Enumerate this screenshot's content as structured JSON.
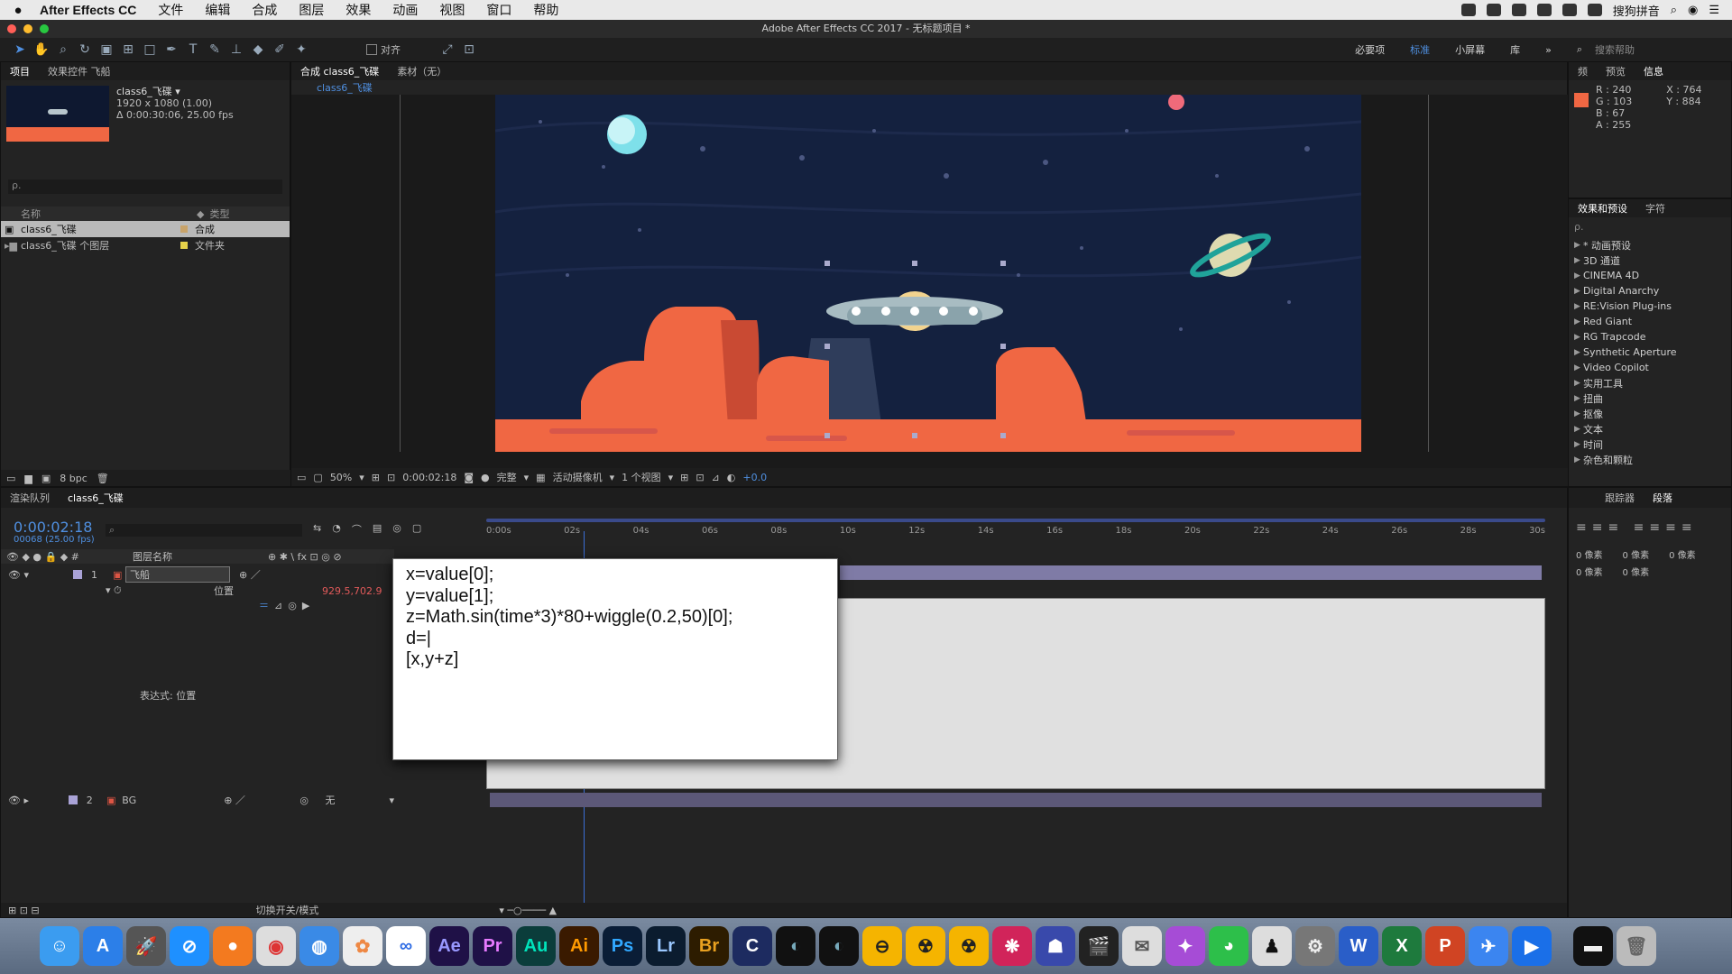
{
  "menubar": {
    "app_name": "After Effects CC",
    "menus": [
      "文件",
      "编辑",
      "合成",
      "图层",
      "效果",
      "动画",
      "视图",
      "窗口",
      "帮助"
    ],
    "input_method": "搜狗拼音"
  },
  "window": {
    "title": "Adobe After Effects CC 2017 - 无标题项目 *"
  },
  "toolbar": {
    "align_label": "对齐",
    "workspaces": [
      "必要项",
      "标准",
      "小屏幕",
      "库"
    ],
    "active_workspace": "标准",
    "search_help": "搜索帮助"
  },
  "project_panel": {
    "tabs": [
      "项目",
      "效果控件 飞船"
    ],
    "comp_name": "class6_飞碟 ▾",
    "comp_size": "1920 x 1080 (1.00)",
    "comp_duration": "Δ 0:00:30:06, 25.00 fps",
    "search_placeholder": "ρ.",
    "col_name": "名称",
    "col_type": "类型",
    "items": [
      {
        "name": "class6_飞碟",
        "type": "合成"
      },
      {
        "name": "class6_飞碟 个图层",
        "type": "文件夹"
      }
    ],
    "bpc": "8 bpc"
  },
  "viewer": {
    "tabs": [
      "合成 class6_飞碟",
      "素材（无）"
    ],
    "breadcrumb": "class6_飞碟",
    "zoom": "50%",
    "timecode": "0:00:02:18",
    "quality": "完整",
    "camera": "活动摄像机",
    "views": "1 个视图",
    "exposure": "+0.0"
  },
  "info_panel": {
    "tabs": [
      "频",
      "预览",
      "信息"
    ],
    "r": "R : 240",
    "g": "G : 103",
    "b": "B : 67",
    "a": "A : 255",
    "x": "X : 764",
    "y": "Y : 884",
    "swatch": "#f06743"
  },
  "effects_panel": {
    "tabs": [
      "效果和预设",
      "字符"
    ],
    "search_placeholder": "ρ.",
    "items": [
      "* 动画预设",
      "3D 通道",
      "CINEMA 4D",
      "Digital Anarchy",
      "RE:Vision Plug-ins",
      "Red Giant",
      "RG Trapcode",
      "Synthetic Aperture",
      "Video Copilot",
      "实用工具",
      "扭曲",
      "抠像",
      "文本",
      "时间",
      "杂色和颗粒"
    ]
  },
  "timeline": {
    "tabs": [
      "渲染队列",
      "class6_飞碟"
    ],
    "timecode": "0:00:02:18",
    "frame_info": "00068 (25.00 fps)",
    "col_layer_name": "图层名称",
    "layers": [
      {
        "num": "1",
        "name": "飞船"
      },
      {
        "num": "2",
        "name": "BG",
        "parent": "无"
      }
    ],
    "property_name": "位置",
    "property_value": "929.5,702.9",
    "expression_label": "表达式: 位置",
    "ruler": [
      "0:00s",
      "02s",
      "04s",
      "06s",
      "08s",
      "10s",
      "12s",
      "14s",
      "16s",
      "18s",
      "20s",
      "22s",
      "24s",
      "26s",
      "28s",
      "30s"
    ],
    "toggle_label": "切换开关/模式",
    "expression_lines": [
      "x=value[0];",
      "y=value[1];",
      "z=Math.sin(time*3)*80+wiggle(0.2,50)[0];",
      "d=|",
      "[x,y+z]"
    ]
  },
  "tracker_panel": {
    "tabs": [
      "跟踪器",
      "段落"
    ],
    "px_labels": [
      "0 像素",
      "0 像素",
      "0 像素",
      "0 像素",
      "0 像素"
    ]
  },
  "dock": {
    "apps": [
      "Finder",
      "App Store",
      "Launchpad",
      "Safari",
      "Firefox",
      "Chrome",
      "QQ Browser",
      "Photos",
      "Baidu",
      "Ae",
      "Pr",
      "Au",
      "Ai",
      "Ps",
      "Lr",
      "Br",
      "C",
      "Cinema",
      "Cinema2",
      "Handbrake",
      "Nuke",
      "NukeX",
      "DaVinci",
      "Proxyman",
      "Final Cut",
      "Preview",
      "Motion",
      "WeChat",
      "QQ",
      "Prefs",
      "W",
      "X",
      "P",
      "Feishu",
      "QuickTime",
      "Terminal",
      "Trash"
    ],
    "colors": {
      "Ae": "#1f1147",
      "Pr": "#1f1147",
      "Au": "#0b3d3b",
      "Ai": "#3a1a00",
      "Ps": "#0a1d36",
      "Lr": "#0b1c2f",
      "Br": "#2d1c00"
    }
  }
}
